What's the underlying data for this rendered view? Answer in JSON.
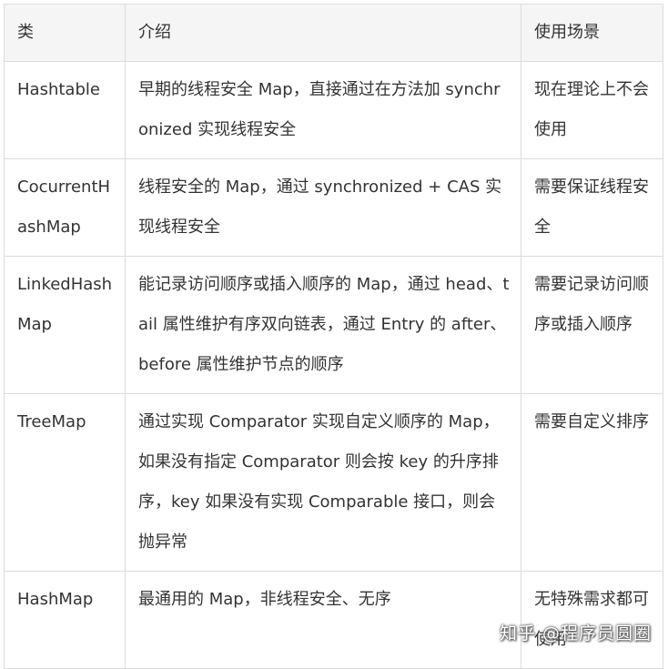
{
  "table": {
    "headers": [
      "类",
      "介绍",
      "使用场景"
    ],
    "rows": [
      {
        "cls": "Hashtable",
        "intro": "早期的线程安全 Map，直接通过在方法加 synchronized 实现线程安全",
        "scene": "现在理论上不会使用"
      },
      {
        "cls": "CocurrentHashMap",
        "intro": "线程安全的 Map，通过 synchronized + CAS 实现线程安全",
        "scene": "需要保证线程安全"
      },
      {
        "cls": "LinkedHashMap",
        "intro": "能记录访问顺序或插入顺序的 Map，通过 head、tail 属性维护有序双向链表，通过 Entry 的 after、before 属性维护节点的顺序",
        "scene": "需要记录访问顺序或插入顺序"
      },
      {
        "cls": "TreeMap",
        "intro": "通过实现 Comparator 实现自定义顺序的 Map，如果没有指定 Comparator 则会按 key 的升序排序，key 如果没有实现 Comparable 接口，则会抛异常",
        "scene": "需要自定义排序"
      },
      {
        "cls": "HashMap",
        "intro": "最通用的 Map，非线程安全、无序",
        "scene": "无特殊需求都可使用"
      }
    ]
  },
  "watermark": "知乎 @程序员圆圈"
}
